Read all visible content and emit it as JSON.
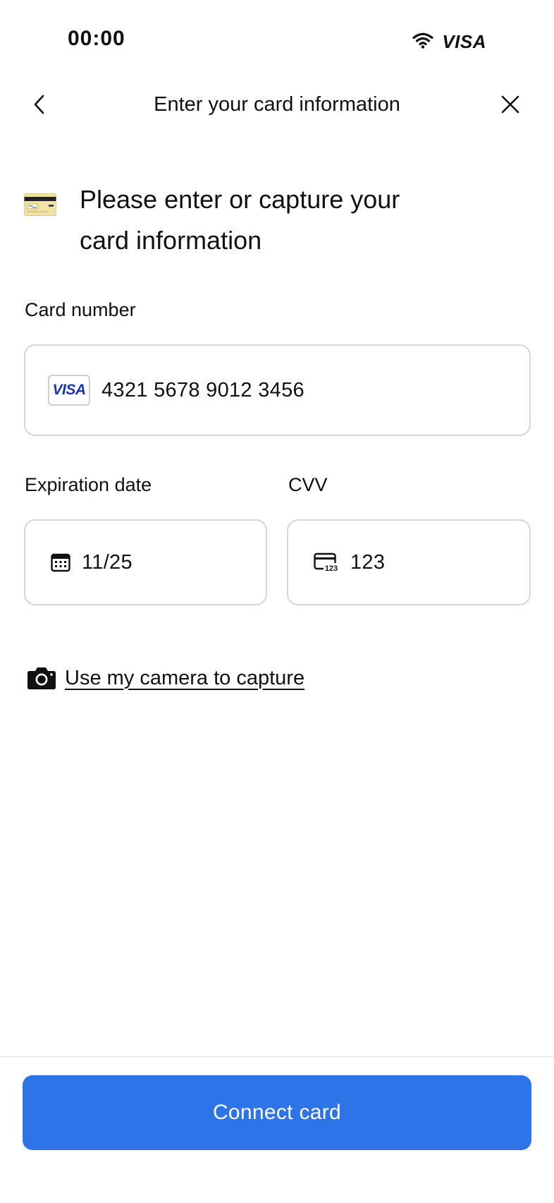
{
  "status_bar": {
    "time": "00:00",
    "carrier": "VISA",
    "icons": [
      "wifi-icon"
    ]
  },
  "nav": {
    "title": "Enter your card information",
    "back_icon": "chevron-left-icon",
    "close_icon": "close-icon"
  },
  "heading": {
    "icon": "credit-card-emoji-icon",
    "line1": "Please enter or capture your",
    "line2": "card information"
  },
  "card_number": {
    "label": "Card number",
    "brand": "VISA",
    "value": "4321 5678 9012 3456"
  },
  "expiration": {
    "label": "Expiration date",
    "icon": "calendar-icon",
    "value": "11/25"
  },
  "cvv": {
    "label": "CVV",
    "icon": "card-cvv-icon",
    "value": "123"
  },
  "camera": {
    "icon": "camera-icon",
    "label": "Use my camera to capture"
  },
  "footer": {
    "connect_label": "Connect card"
  },
  "colors": {
    "primary": "#2c74e8",
    "visa_blue": "#1a35b8",
    "border": "#d6d6d6",
    "text": "#111111"
  }
}
